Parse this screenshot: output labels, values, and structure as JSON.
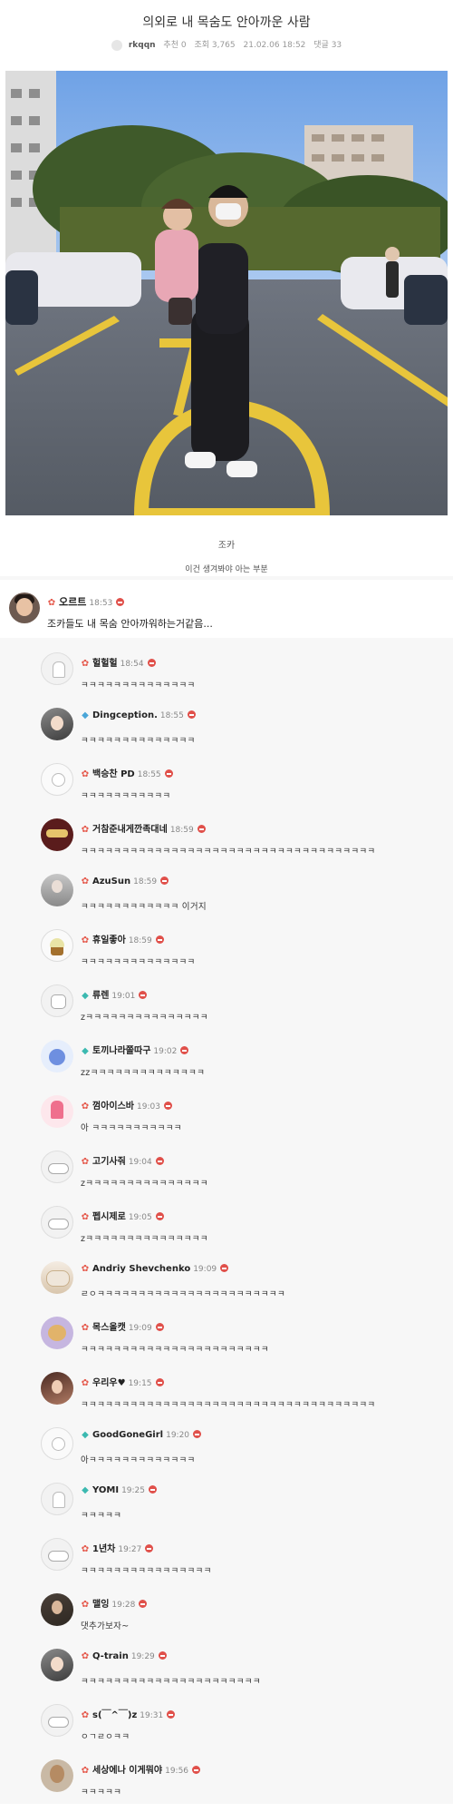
{
  "post": {
    "title": "의외로 내 목숨도 안아까운 사람",
    "author": "rkqqn",
    "recommend": "추천 0",
    "views": "조회 3,765",
    "date": "21.02.06 18:52",
    "comments_count": "댓글 33"
  },
  "captions": {
    "line1": "조카",
    "line2": "이건 생겨봐야 아는 부분"
  },
  "main_comment": {
    "name": "오르트",
    "time": "18:53",
    "text": "조카들도 내 목숨 안아까워하는거같음..."
  },
  "replies": [
    {
      "name": "헐헐헐",
      "time": "18:54",
      "text": "ㅋㅋㅋㅋㅋㅋㅋㅋㅋㅋㅋㅋㅋㅋ",
      "avatar": "av-ghost",
      "badge": "red"
    },
    {
      "name": "Dingception.",
      "time": "18:55",
      "text": "ㅋㅋㅋㅋㅋㅋㅋㅋㅋㅋㅋㅋㅋㅋ",
      "avatar": "av-anime",
      "badge": "blue"
    },
    {
      "name": "백승찬 PD",
      "time": "18:55",
      "text": "ㅋㅋㅋㅋㅋㅋㅋㅋㅋㅋㅋ",
      "avatar": "av-egg",
      "badge": "red"
    },
    {
      "name": "거참준내게깐족대네",
      "time": "18:59",
      "text": "ㅋㅋㅋㅋㅋㅋㅋㅋㅋㅋㅋㅋㅋㅋㅋㅋㅋㅋㅋㅋㅋㅋㅋㅋㅋㅋㅋㅋㅋㅋㅋㅋㅋㅋㅋㅋ",
      "avatar": "av-mask",
      "badge": "red"
    },
    {
      "name": "AzuSun",
      "time": "18:59",
      "text": "ㅋㅋㅋㅋㅋㅋㅋㅋㅋㅋㅋㅋ 이거지",
      "avatar": "av-gray-person",
      "badge": "red"
    },
    {
      "name": "휴일좋아",
      "time": "18:59",
      "text": "ㅋㅋㅋㅋㅋㅋㅋㅋㅋㅋㅋㅋㅋㅋ",
      "avatar": "av-cupcake",
      "badge": "red"
    },
    {
      "name": "류렌",
      "time": "19:01",
      "text": "zㅋㅋㅋㅋㅋㅋㅋㅋㅋㅋㅋㅋㅋㅋㅋ",
      "avatar": "av-robot",
      "badge": "teal"
    },
    {
      "name": "토끼나라쫄따구",
      "time": "19:02",
      "text": "zzㅋㅋㅋㅋㅋㅋㅋㅋㅋㅋㅋㅋㅋㅋ",
      "avatar": "av-bunny",
      "badge": "teal"
    },
    {
      "name": "껌아이스바",
      "time": "19:03",
      "text": "아 ㅋㅋㅋㅋㅋㅋㅋㅋㅋㅋㅋ",
      "avatar": "av-popsicle",
      "badge": "red"
    },
    {
      "name": "고기사줘",
      "time": "19:04",
      "text": "zㅋㅋㅋㅋㅋㅋㅋㅋㅋㅋㅋㅋㅋㅋㅋ",
      "avatar": "av-cloud",
      "badge": "red"
    },
    {
      "name": "펩시제로",
      "time": "19:05",
      "text": "zㅋㅋㅋㅋㅋㅋㅋㅋㅋㅋㅋㅋㅋㅋㅋ",
      "avatar": "av-cloud",
      "badge": "red"
    },
    {
      "name": "Andriy Shevchenko",
      "time": "19:09",
      "text": "ㄹㅇㅋㅋㅋㅋㅋㅋㅋㅋㅋㅋㅋㅋㅋㅋㅋㅋㅋㅋㅋㅋㅋㅋㅋ",
      "avatar": "av-dogs",
      "badge": "red"
    },
    {
      "name": "목스올캣",
      "time": "19:09",
      "text": "ㅋㅋㅋㅋㅋㅋㅋㅋㅋㅋㅋㅋㅋㅋㅋㅋㅋㅋㅋㅋㅋㅋㅋ",
      "avatar": "av-cat-purple",
      "badge": "red"
    },
    {
      "name": "우리우♥",
      "time": "19:15",
      "text": "ㅋㅋㅋㅋㅋㅋㅋㅋㅋㅋㅋㅋㅋㅋㅋㅋㅋㅋㅋㅋㅋㅋㅋㅋㅋㅋㅋㅋㅋㅋㅋㅋㅋㅋㅋㅋ",
      "avatar": "av-woman",
      "badge": "red"
    },
    {
      "name": "GoodGoneGirl",
      "time": "19:20",
      "text": "아ㅋㅋㅋㅋㅋㅋㅋㅋㅋㅋㅋㅋㅋ",
      "avatar": "av-egg",
      "badge": "teal"
    },
    {
      "name": "YOMI",
      "time": "19:25",
      "text": "ㅋㅋㅋㅋㅋ",
      "avatar": "av-ghost",
      "badge": "teal"
    },
    {
      "name": "1년차",
      "time": "19:27",
      "text": "ㅋㅋㅋㅋㅋㅋㅋㅋㅋㅋㅋㅋㅋㅋㅋㅋ",
      "avatar": "av-cloud",
      "badge": "red"
    },
    {
      "name": "맬잉",
      "time": "19:28",
      "text": "댓추가보자~",
      "avatar": "av-guy",
      "badge": "red"
    },
    {
      "name": "Q-train",
      "time": "19:29",
      "text": "ㅋㅋㅋㅋㅋㅋㅋㅋㅋㅋㅋㅋㅋㅋㅋㅋㅋㅋㅋㅋㅋㅋ",
      "avatar": "av-anime",
      "badge": "red"
    },
    {
      "name": "s(￣^￣)z",
      "time": "19:31",
      "text": "ㅇㄱㄹㅇㅋㅋ",
      "avatar": "av-cloud",
      "badge": "red"
    },
    {
      "name": "세상에나 이게뭐야",
      "time": "19:56",
      "text": "ㅋㅋㅋㅋㅋ",
      "avatar": "av-man-bald",
      "badge": "red"
    }
  ],
  "colors": {
    "badge_red": "#e5584b",
    "badge_blue": "#4aa6d8",
    "badge_teal": "#3bb9b0",
    "delete": "#e0504a"
  }
}
